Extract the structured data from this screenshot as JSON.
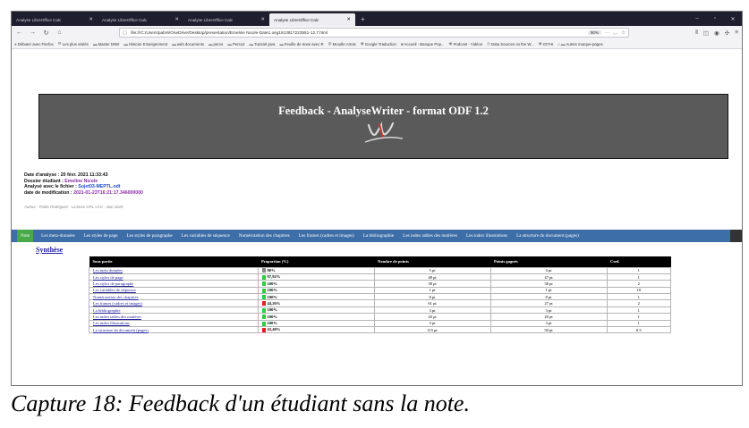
{
  "tabs": [
    {
      "title": "Analyse LibreOffice Calc",
      "active": false
    },
    {
      "title": "Analyse LibreOffice Calc",
      "active": false
    },
    {
      "title": "Analyse LibreOffice Calc",
      "active": false
    },
    {
      "title": "Analyse LibreOffice Calc",
      "active": true
    }
  ],
  "nav": {
    "url": "file:///C:/Users/pabr6/OneDrive/Desktop/presentation/Emeline Nicole-Date1.oeg1613817223551-12.7.html",
    "zoom": "90%"
  },
  "bookmarks": [
    {
      "label": "Débuter avec Firefox",
      "icon": "firefox-icon"
    },
    {
      "label": "Les plus visités",
      "icon": "gear-icon"
    },
    {
      "label": "Master DIWI",
      "icon": "folder-icon"
    },
    {
      "label": "Histoire Enseignement",
      "icon": "folder-icon"
    },
    {
      "label": "web documents",
      "icon": "folder-icon"
    },
    {
      "label": "perso",
      "icon": "folder-icon"
    },
    {
      "label": "Perso2",
      "icon": "folder-icon"
    },
    {
      "label": "Tutoriel java",
      "icon": "folder-icon"
    },
    {
      "label": "Feuille de texte avec R",
      "icon": "folder-icon"
    },
    {
      "label": "Moodle Artois",
      "icon": "moodle-icon"
    },
    {
      "label": "Google Traduction",
      "icon": "google-icon"
    },
    {
      "label": "Accueil - Banque Pop...",
      "icon": "bank-icon"
    },
    {
      "label": "Podcast - Vidéos",
      "icon": "podcast-icon"
    },
    {
      "label": "Data Sources on the W...",
      "icon": "globe-icon"
    },
    {
      "label": "GITHI",
      "icon": "github-icon"
    },
    {
      "label": "Autres marque-pages",
      "icon": "folder-icon"
    }
  ],
  "page": {
    "banner_title": "Feedback - AnalyseWriter - format ODF 1.2",
    "info": {
      "date_label": "Date d'analyse : ",
      "date_value": "20 févr. 2021 11:33:43",
      "student_label": "Dossier étudiant : ",
      "student_value": "Emeline Nicole",
      "file_label": "Analysé avec le fichier : ",
      "file_value": "Sujet03-MEPTL.odt",
      "modif_label": "date de modification : ",
      "modif_value": "2021-01-23T16:21:17.346000000"
    },
    "author": "Auteur : Pablo Rodriguez - Licence GPL v3.0 - Juin 2020",
    "menu": [
      "Note",
      "Les meta-données",
      "Les styles de page",
      "Les styles de paragraphe",
      "Les variables de séquence",
      "Numérotation des chapitres",
      "Les frames (cadres et images)",
      "La bibliographie",
      "Les index tables des matières",
      "Les index illustrations",
      "La structure du document (pages)"
    ],
    "section_title": "Synthèse",
    "table": {
      "headers": [
        "Sous partie",
        "Proportion (%)",
        "Nombre de points",
        "Points gagnés",
        "Coef."
      ],
      "rows": [
        {
          "name": "Les meta données",
          "prop": "80%",
          "pct": 80,
          "color": "#888888",
          "points": "5 pt",
          "gained": "4 pt",
          "coef": "1"
        },
        {
          "name": "Les styles de page",
          "prop": "97,92%",
          "pct": 97.92,
          "color": "#2ecc40",
          "points": "48 pt",
          "gained": "47 pt",
          "coef": "1"
        },
        {
          "name": "Les styles de paragraphe",
          "prop": "100%",
          "pct": 100,
          "color": "#2ecc40",
          "points": "38 pt",
          "gained": "38 pt",
          "coef": "2"
        },
        {
          "name": "Les variables de séquence",
          "prop": "100%",
          "pct": 100,
          "color": "#2ecc40",
          "points": "1 pt",
          "gained": "1 pt",
          "coef": "10"
        },
        {
          "name": "Numérotation des chapitres",
          "prop": "100%",
          "pct": 100,
          "color": "#2ecc40",
          "points": "8 pt",
          "gained": "8 pt",
          "coef": "1"
        },
        {
          "name": "Les frames (cadres et images)",
          "prop": "44,26%",
          "pct": 44.26,
          "color": "#e02020",
          "points": "61 pt",
          "gained": "27 pt",
          "coef": "2"
        },
        {
          "name": "La bibliographie",
          "prop": "100%",
          "pct": 100,
          "color": "#2ecc40",
          "points": "3 pt",
          "gained": "3 pt",
          "coef": "1"
        },
        {
          "name": "Les index tables des matières",
          "prop": "100%",
          "pct": 100,
          "color": "#2ecc40",
          "points": "20 pt",
          "gained": "20 pt",
          "coef": "1"
        },
        {
          "name": "Les index illustrations",
          "prop": "100%",
          "pct": 100,
          "color": "#2ecc40",
          "points": "3 pt",
          "gained": "3 pt",
          "coef": "1"
        },
        {
          "name": "La structure du document (pages)",
          "prop": "43,48%",
          "pct": 43.48,
          "color": "#e02020",
          "points": "115 pt",
          "gained": "50 pt",
          "coef": "0.5"
        }
      ]
    }
  },
  "caption": "Capture 18: Feedback d'un étudiant sans la note."
}
